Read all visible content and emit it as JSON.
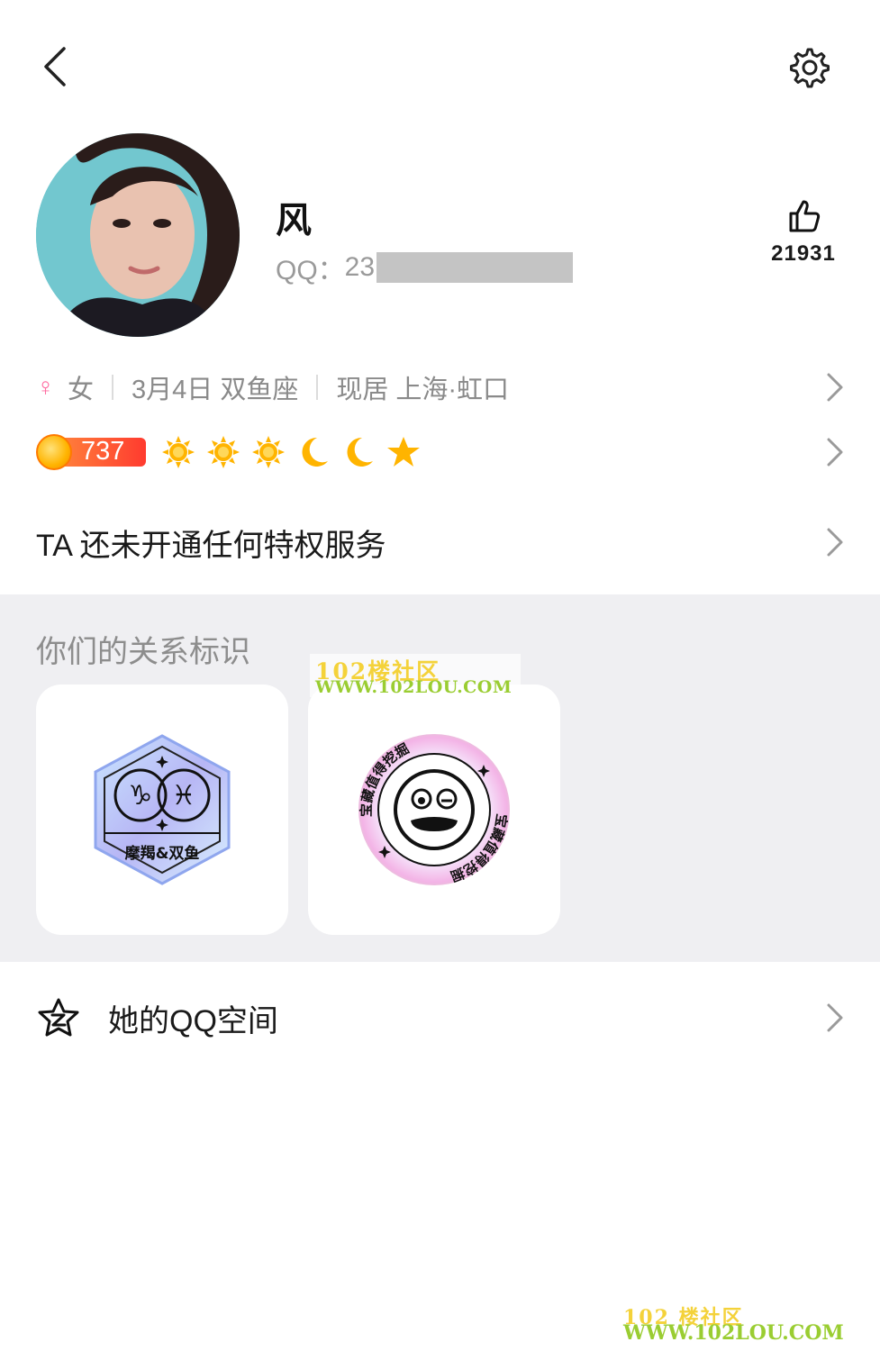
{
  "topbar": {
    "back_icon": "back-chevron-icon",
    "settings_icon": "gear-icon"
  },
  "profile": {
    "name": "风",
    "qq_label": "QQ：",
    "qq_visible": "23",
    "like_count": "21931",
    "like_icon": "thumbs-up-icon"
  },
  "info": {
    "gender_symbol": "♀",
    "gender": "女",
    "birthday_sign": "3月4日 双鱼座",
    "residence": "现居 上海·虹口"
  },
  "level": {
    "value": "737",
    "icons": [
      "sun-icon",
      "sun-icon",
      "sun-icon",
      "moon-icon",
      "moon-icon",
      "star-icon"
    ],
    "colors": {
      "sun": "#ffb400",
      "moon": "#ffb400",
      "star": "#ffb400",
      "badge_start": "#ff8a3d",
      "badge_end": "#ff3b2f"
    }
  },
  "privilege": {
    "text": "TA 还未开通任何特权服务"
  },
  "relationship": {
    "title": "你们的关系标识",
    "badges": [
      {
        "label": "摩羯&双鱼",
        "symbols": "♑♓"
      },
      {
        "label": "宝藏值得挖掘"
      }
    ]
  },
  "zone": {
    "label": "她的QQ空间",
    "icon": "qzone-star-icon"
  },
  "watermarks": {
    "mid_cn": "102楼社区",
    "mid_en": "WWW.102LOU.COM",
    "bottom_cn": "102 楼社区",
    "bottom_en": "WWW.102LOU.COM"
  }
}
